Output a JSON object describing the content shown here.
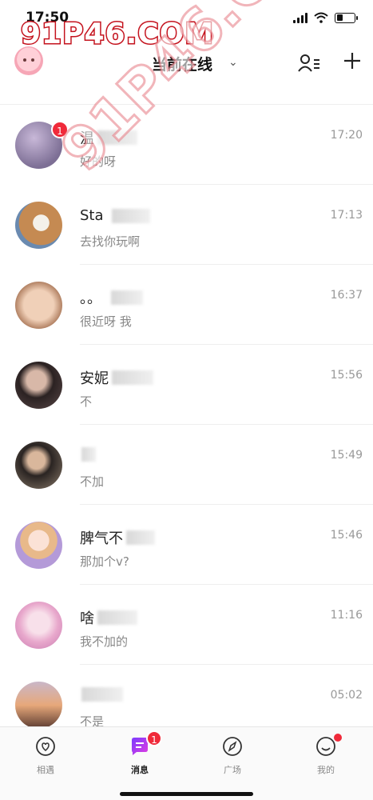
{
  "status_bar": {
    "time": "17:50"
  },
  "watermark": {
    "text": "91P46.COM"
  },
  "header": {
    "title": "当前在线",
    "chevron": "⌄"
  },
  "chats": [
    {
      "name": "温",
      "message": "好的呀",
      "time": "17:20",
      "unread": "1",
      "avatar_color": "#9a8fb0"
    },
    {
      "name": "Sta",
      "message": "去找你玩啊",
      "time": "17:13",
      "avatar_color": "#b07b55"
    },
    {
      "name": "。。",
      "message": "很近呀 我",
      "time": "16:37",
      "avatar_color": "#caa48a"
    },
    {
      "name": "安妮",
      "message": "不",
      "time": "15:56",
      "avatar_color": "#4a3a3a"
    },
    {
      "name": "",
      "message": "不加",
      "time": "15:49",
      "avatar_color": "#6b5a4a"
    },
    {
      "name": "脾气不",
      "message": "那加个v?",
      "time": "15:46",
      "avatar_color": "#c9a0c8"
    },
    {
      "name": "啥",
      "message": "我不加的",
      "time": "11:16",
      "avatar_color": "#e6b0cf"
    },
    {
      "name": "",
      "message": "不是",
      "time": "05:02",
      "avatar_color": "#d8956a"
    }
  ],
  "tabs": [
    {
      "label": "相遇",
      "icon": "heart-icon"
    },
    {
      "label": "消息",
      "icon": "message-icon",
      "badge": "1"
    },
    {
      "label": "广场",
      "icon": "compass-icon"
    },
    {
      "label": "我的",
      "icon": "smile-icon"
    }
  ]
}
